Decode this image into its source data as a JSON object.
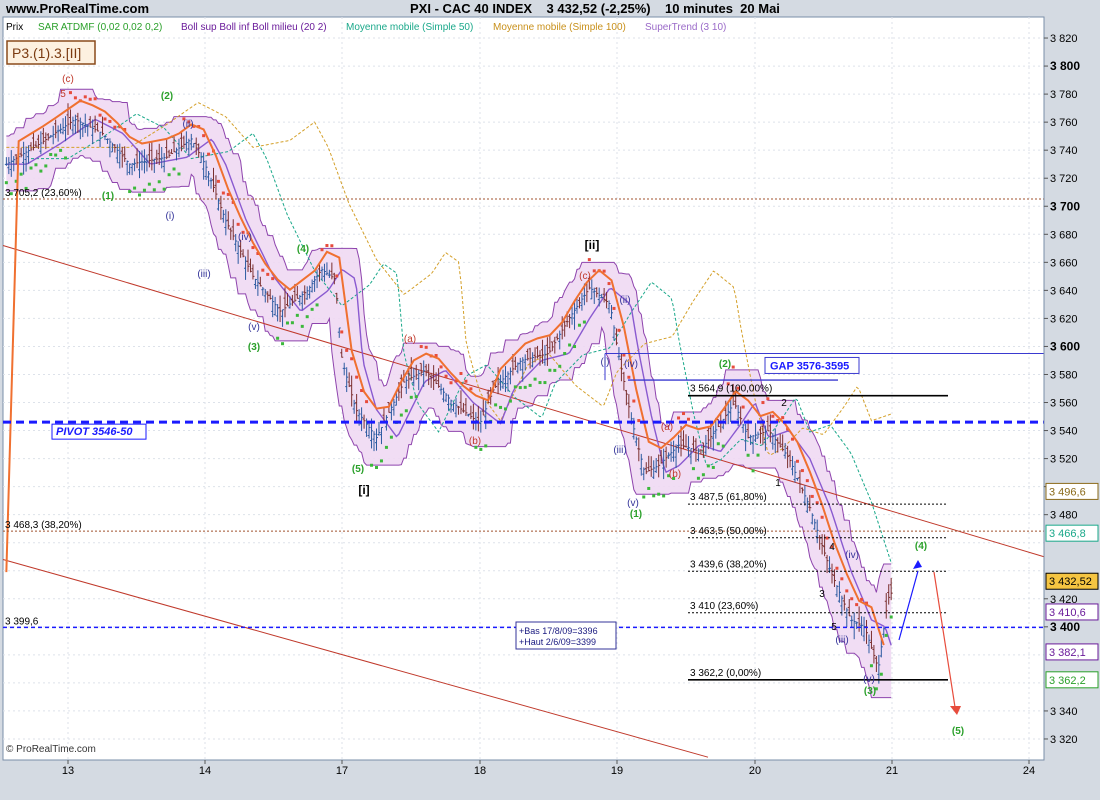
{
  "header": {
    "site": "www.ProRealTime.com",
    "title": "PXI - CAC 40 INDEX    3 432,52 (-2,25%)    10 minutes  20 Mai"
  },
  "legend": [
    {
      "text": "Prix",
      "color": "#000000"
    },
    {
      "text": "SAR ATDMF (0,02 0,02 0,2)",
      "color": "#2aa02a"
    },
    {
      "text": "Boll sup Boll inf Boll milieu (20 2)",
      "color": "#6a1b9a"
    },
    {
      "text": "Moyenne mobile (Simple 50)",
      "color": "#1aa88a"
    },
    {
      "text": "Moyenne mobile (Simple 100)",
      "color": "#c8901a"
    },
    {
      "text": "SuperTrend (3 10)",
      "color": "#9a6ac8"
    }
  ],
  "label_box": "P3.(1).3.[II]",
  "copyright": "© ProRealTime.com",
  "chart_data": {
    "type": "candlestick",
    "x_ticks": [
      "13",
      "14",
      "17",
      "18",
      "19",
      "20",
      "21",
      "24"
    ],
    "y_ticks": [
      3320,
      3340,
      3360,
      3380,
      3400,
      3420,
      3440,
      3460,
      3480,
      3500,
      3520,
      3540,
      3560,
      3580,
      3600,
      3620,
      3640,
      3660,
      3680,
      3700,
      3720,
      3740,
      3760,
      3780,
      3800,
      3820
    ],
    "y_tick_labels": [
      "3 320",
      "3 340",
      "",
      "",
      "3 400",
      "3 420",
      "",
      "",
      "3 480",
      "3 500",
      "3 520",
      "3 540",
      "3 560",
      "3 580",
      "3 600",
      "3 620",
      "3 640",
      "3 660",
      "3 680",
      "3 700",
      "3 720",
      "3 740",
      "3 760",
      "3 780",
      "3 800",
      "3 820"
    ],
    "ylim": [
      3305,
      3835
    ],
    "bold_ticks": [
      3400,
      3600,
      3700,
      3800
    ],
    "right_labels": [
      {
        "text": "3 496,6",
        "y": 3496.6,
        "color": "#8a6a1a",
        "bg": "#ffffff"
      },
      {
        "text": "3 466,8",
        "y": 3466.8,
        "color": "#1aa88a",
        "bg": "#ffffff"
      },
      {
        "text": "3 432,52",
        "y": 3432.52,
        "color": "#000000",
        "bg": "#f5c542"
      },
      {
        "text": "3 410,6",
        "y": 3410.6,
        "color": "#6a1b9a",
        "bg": "#ffffff"
      },
      {
        "text": "3 382,1",
        "y": 3382.1,
        "color": "#6a1b9a",
        "bg": "#ffffff"
      },
      {
        "text": "3 362,2",
        "y": 3362.2,
        "color": "#2aa02a",
        "bg": "#ffffff"
      }
    ],
    "fib_lines": [
      {
        "label": "3 705,2 (23,60%)",
        "y": 3705.2
      },
      {
        "label": "3 468,3 (38,20%)",
        "y": 3468.3
      },
      {
        "label": "3 399,6",
        "y": 3399.6
      }
    ],
    "retracements": [
      {
        "label": "3 564,9 (100,00%)",
        "y": 3564.9
      },
      {
        "label": "3 487,5 (61,80%)",
        "y": 3487.5
      },
      {
        "label": "3 463,5 (50,00%)",
        "y": 3463.5
      },
      {
        "label": "3 439,6 (38,20%)",
        "y": 3439.6
      },
      {
        "label": "3 410 (23,60%)",
        "y": 3410
      },
      {
        "label": "3 362,2 (0,00%)",
        "y": 3362.2
      }
    ],
    "pivot": {
      "label": "PIVOT 3546-50",
      "y": 3546
    },
    "gap": {
      "label": "GAP 3576-3595",
      "y1": 3576,
      "y2": 3595
    },
    "info_box": [
      "+Bas 17/8/09=3396",
      "+Haut 2/6/09=3399"
    ],
    "waves": [
      {
        "text": "(c)",
        "color": "#c0392b"
      },
      {
        "text": "5",
        "color": "#c0392b"
      },
      {
        "text": "(2)",
        "color": "#2aa02a"
      },
      {
        "text": "(ii)",
        "color": "#333399"
      },
      {
        "text": "(1)",
        "color": "#2aa02a"
      },
      {
        "text": "(i)",
        "color": "#333399"
      },
      {
        "text": "(iv)",
        "color": "#333399"
      },
      {
        "text": "(4)",
        "color": "#2aa02a"
      },
      {
        "text": "(iii)",
        "color": "#333399"
      },
      {
        "text": "(v)",
        "color": "#333399"
      },
      {
        "text": "(3)",
        "color": "#2aa02a"
      },
      {
        "text": "(a)",
        "color": "#c0392b"
      },
      {
        "text": "(b)",
        "color": "#c0392b"
      },
      {
        "text": "(5)",
        "color": "#2aa02a"
      },
      {
        "text": "[i]",
        "color": "#000000"
      },
      {
        "text": "[ii]",
        "color": "#000000"
      },
      {
        "text": "(c)",
        "color": "#c0392b"
      },
      {
        "text": "(ii)",
        "color": "#333399"
      },
      {
        "text": "(i)",
        "color": "#333399"
      },
      {
        "text": "(iv)",
        "color": "#333399"
      },
      {
        "text": "(iii)",
        "color": "#333399"
      },
      {
        "text": "(v)",
        "color": "#333399"
      },
      {
        "text": "(1)",
        "color": "#2aa02a"
      },
      {
        "text": "(a)",
        "color": "#c0392b"
      },
      {
        "text": "(b)",
        "color": "#c0392b"
      },
      {
        "text": "(2)",
        "color": "#2aa02a"
      },
      {
        "text": "1",
        "color": "#000000"
      },
      {
        "text": "2",
        "color": "#000000"
      },
      {
        "text": "(iv)",
        "color": "#333399"
      },
      {
        "text": "4",
        "color": "#000000"
      },
      {
        "text": "3",
        "color": "#000000"
      },
      {
        "text": "5",
        "color": "#000000"
      },
      {
        "text": "(iii)",
        "color": "#333399"
      },
      {
        "text": "(v)",
        "color": "#333399"
      },
      {
        "text": "(3)",
        "color": "#2aa02a"
      },
      {
        "text": "(4)",
        "color": "#2aa02a"
      },
      {
        "text": "(5)",
        "color": "#2aa02a"
      }
    ]
  }
}
